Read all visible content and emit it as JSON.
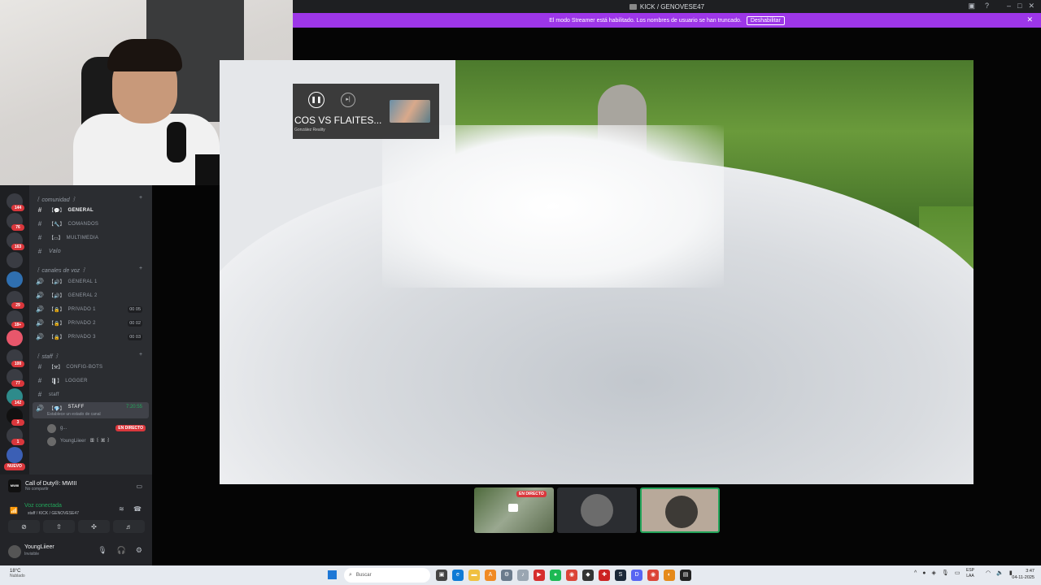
{
  "window": {
    "title": "KICK / GENOVESE47"
  },
  "banner": {
    "message": "El modo Streamer está habilitado. Los nombres de usuario se han truncado.",
    "disable_label": "Deshabilitar",
    "close_icon": "close-icon",
    "color": "#9d36e8"
  },
  "servers": {
    "badges": [
      "144",
      "76",
      "163",
      "29",
      "18+",
      "100",
      "77",
      "142",
      "3",
      "1"
    ],
    "new_label": "NUEVO"
  },
  "categories": {
    "comunidad": "꒰ comunidad ꒱",
    "canales_voz": "꒰ canales de voz ꒱",
    "staff": "꒰ staff ꒱"
  },
  "channels": {
    "general": "GENERAL",
    "comandos": "COMANDOS",
    "multimedia": "MULTIMEDIA",
    "valo": "Valo",
    "voice_general1": "GENERAL 1",
    "voice_general2": "GENERAL 2",
    "privado1": "PRIVADO 1",
    "privado1_count": "00 05",
    "privado2": "PRIVADO 2",
    "privado2_count": "00 02",
    "privado3": "PRIVADO 3",
    "privado3_count": "00 03",
    "config_bots": "CONFIG-BOTS",
    "logger": "LOGGER",
    "staff_text": "staff",
    "staff_voice": "STAFF",
    "staff_timer": "7:20:55",
    "staff_status": "Establece un estado de canal"
  },
  "voice_users": [
    {
      "name": "g...",
      "live": "EN DIRECTO"
    },
    {
      "name": "YoungLiieer",
      "extra": "ꕥ ꒰ ꕤ ꒱"
    }
  ],
  "activity": {
    "game_icon_text": "MWIII",
    "game": "Call of Duty®: MWIII",
    "status": "No compartir"
  },
  "voice_panel": {
    "title": "Voz conectada",
    "subtitle": "staff / KICK / GENOVESE47"
  },
  "user_panel": {
    "name": "YoungLiieer",
    "status": "Invisible"
  },
  "media": {
    "title": "COS VS FLAITES...",
    "artist": "González Reality"
  },
  "tiles": {
    "live_label": "EN DIRECTO"
  },
  "taskbar": {
    "temp": "18°C",
    "condition": "Nublado",
    "search_placeholder": "Buscar",
    "lang_top": "ESP",
    "lang_bottom": "LAA",
    "time": "3:47",
    "date": "04-11-2025"
  }
}
